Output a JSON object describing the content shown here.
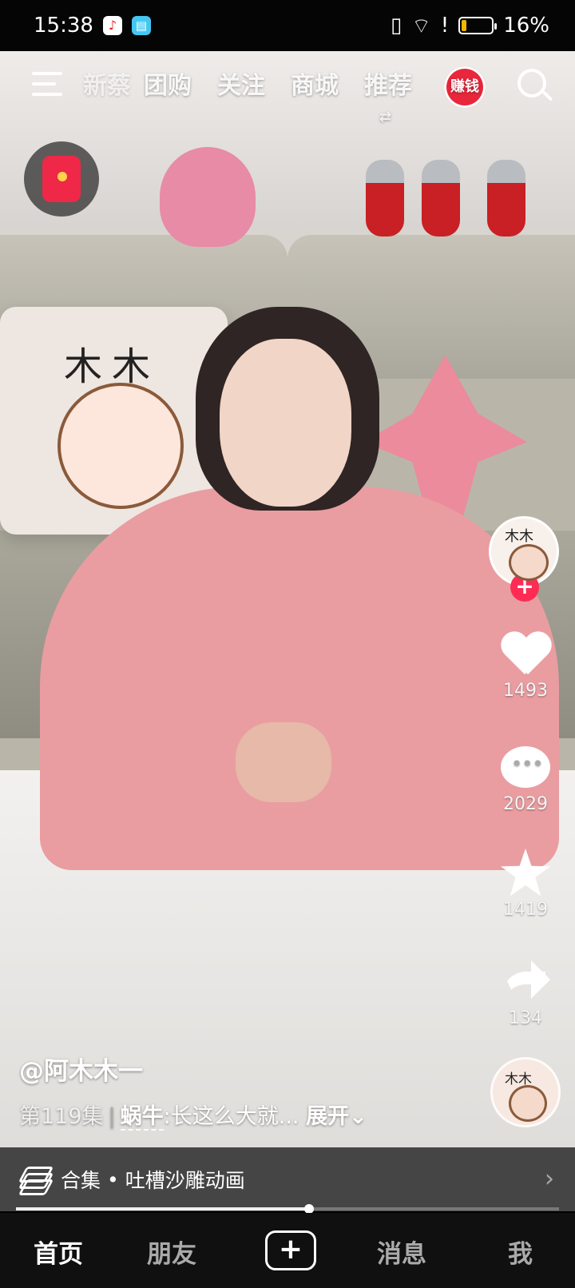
{
  "status": {
    "time": "15:38",
    "battery_percent": "16%",
    "battery_level": 0.16,
    "app_icons": [
      "music-app-icon",
      "book-app-icon"
    ],
    "system_icons": [
      "vibrate-icon",
      "wifi-icon",
      "alert-icon",
      "battery-icon"
    ]
  },
  "top_nav": {
    "partial_tab": "新蔡",
    "tabs": [
      "团购",
      "关注",
      "商城",
      "推荐"
    ],
    "active_tab": "推荐",
    "earn_label": "赚钱",
    "swap_mark": "⇄"
  },
  "actions": {
    "like_count": "1493",
    "comment_count": "2029",
    "favorite_count": "1419",
    "share_count": "134",
    "follow_plus": "+"
  },
  "caption": {
    "username": "@阿木木一",
    "episode": "第119集",
    "divider": "|",
    "topic": "蜗牛",
    "description": ":长这么大就...",
    "expand": "展开",
    "expand_chevron": "⌄"
  },
  "collection": {
    "label": "合集",
    "separator": "•",
    "title": "吐槽沙雕动画",
    "chevron": "›"
  },
  "progress": {
    "played_fraction": 0.54
  },
  "bottom_nav": {
    "items": [
      "首页",
      "朋友",
      "消息",
      "我"
    ],
    "publish_icon": "+",
    "active": "首页"
  },
  "colors": {
    "accent": "#fe2c55",
    "earn_red": "#e8273c",
    "battery_fill": "#f2b600"
  }
}
